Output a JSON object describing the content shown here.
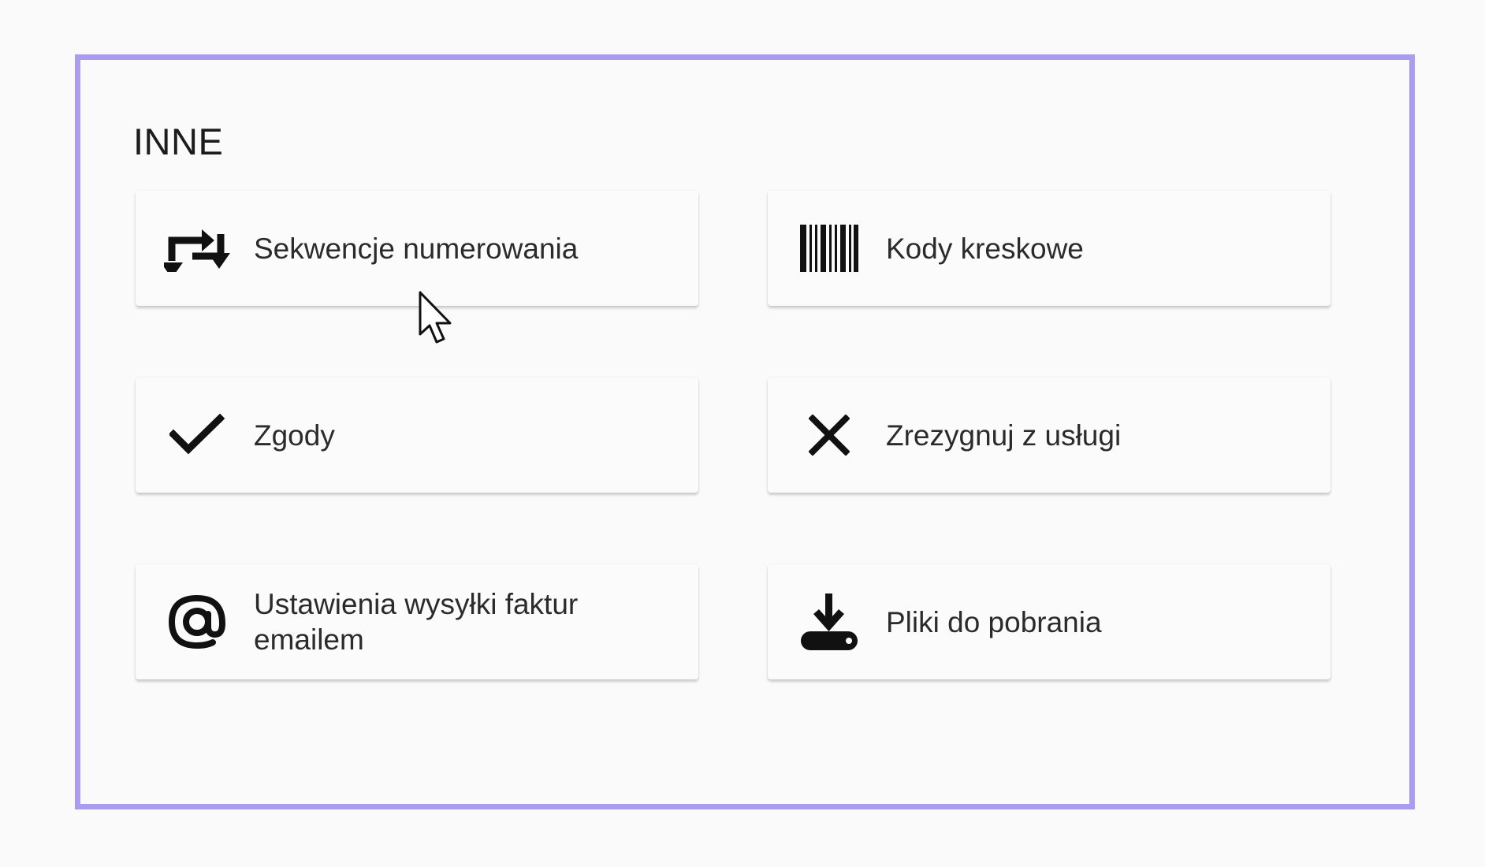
{
  "section": {
    "title": "INNE"
  },
  "colors": {
    "frame_border": "#ab9cf0",
    "background": "#fafafa",
    "card_background": "#fbfbfb",
    "icon_color": "#111111",
    "text_color": "#2b2b2b"
  },
  "cards": [
    {
      "label": "Sekwencje numerowania",
      "icon": "repeat-arrows-icon"
    },
    {
      "label": "Kody kreskowe",
      "icon": "barcode-icon"
    },
    {
      "label": "Zgody",
      "icon": "checkmark-icon"
    },
    {
      "label": "Zrezygnuj z usługi",
      "icon": "close-x-icon"
    },
    {
      "label": "Ustawienia wysyłki faktur emailem",
      "icon": "at-sign-icon"
    },
    {
      "label": "Pliki do pobrania",
      "icon": "download-icon"
    }
  ],
  "cursor": {
    "icon": "mouse-pointer-icon"
  }
}
